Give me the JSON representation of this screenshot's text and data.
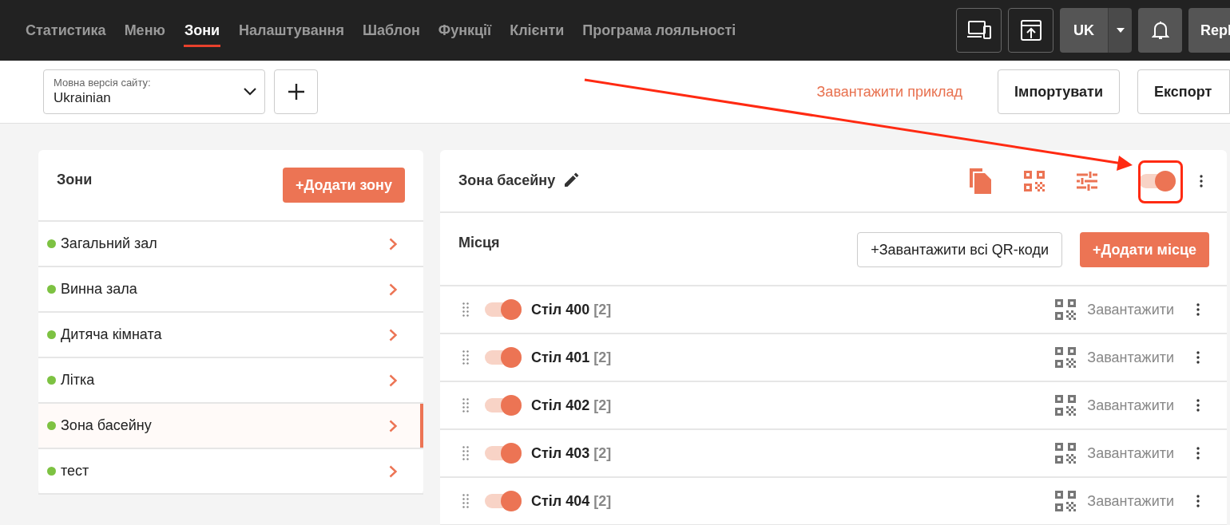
{
  "nav": {
    "tabs": [
      {
        "label": "Статистика",
        "selected": false
      },
      {
        "label": "Меню",
        "selected": false
      },
      {
        "label": "Зони",
        "selected": true
      },
      {
        "label": "Налаштування",
        "selected": false
      },
      {
        "label": "Шаблон",
        "selected": false
      },
      {
        "label": "Функції",
        "selected": false
      },
      {
        "label": "Клієнти",
        "selected": false
      },
      {
        "label": "Програма лояльності",
        "selected": false
      }
    ],
    "language": "UK",
    "user_button": "Repl"
  },
  "toolbar": {
    "language_select": {
      "label": "Мовна версія сайту:",
      "value": "Ukrainian"
    },
    "download_example": "Завантажити приклад",
    "import": "Імпортувати",
    "export": "Експорт"
  },
  "zones_panel": {
    "title": "Зони",
    "add_button": "+Додати зону",
    "zones": [
      {
        "name": "Загальний зал",
        "color": "#7dc242",
        "selected": false
      },
      {
        "name": "Винна зала",
        "color": "#7dc242",
        "selected": false
      },
      {
        "name": "Дитяча кімната",
        "color": "#7dc242",
        "selected": false
      },
      {
        "name": "Літка",
        "color": "#7dc242",
        "selected": false
      },
      {
        "name": "Зона басейну",
        "color": "#7dc242",
        "selected": true
      },
      {
        "name": "тест",
        "color": "#7dc242",
        "selected": false
      }
    ]
  },
  "zone_detail": {
    "title": "Зона басейну",
    "on": true,
    "places_title": "Місця",
    "download_all_qr": "+Завантажити всі QR-коди",
    "add_place": "+Додати місце",
    "places": [
      {
        "name": "Стіл 400",
        "count": "[2]",
        "on": true,
        "download": "Завантажити"
      },
      {
        "name": "Стіл 401",
        "count": "[2]",
        "on": true,
        "download": "Завантажити"
      },
      {
        "name": "Стіл 402",
        "count": "[2]",
        "on": true,
        "download": "Завантажити"
      },
      {
        "name": "Стіл 403",
        "count": "[2]",
        "on": true,
        "download": "Завантажити"
      },
      {
        "name": "Стіл 404",
        "count": "[2]",
        "on": true,
        "download": "Завантажити"
      }
    ]
  }
}
